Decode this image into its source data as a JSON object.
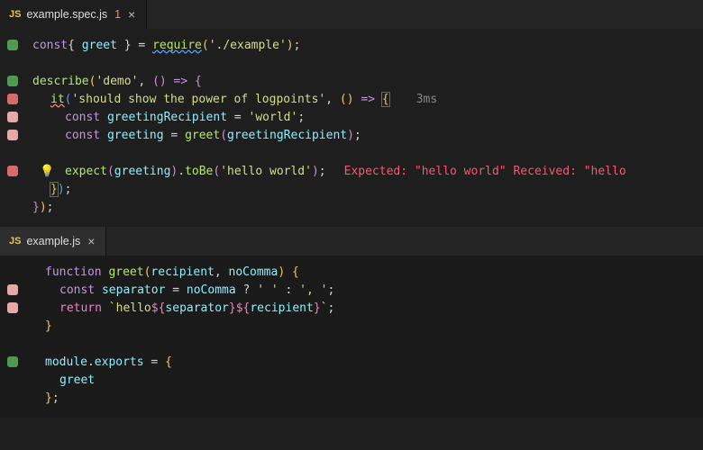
{
  "panes": [
    {
      "tab": {
        "filename": "example.spec.js",
        "error_count": "1",
        "close": "×"
      }
    },
    {
      "tab": {
        "filename": "example.js",
        "close": "×"
      }
    }
  ],
  "spec": {
    "l1": {
      "kw": "const",
      "brace_open": "{ ",
      "v": "greet",
      "brace_close": " }",
      "eq": " = ",
      "fn": "require",
      "po": "(",
      "str": "'./example'",
      "pc": ")",
      "semi": ";"
    },
    "l3": {
      "fn": "describe",
      "po": "(",
      "str": "'demo'",
      "comma": ", ",
      "pp": "(",
      "ppc": ")",
      "arrow": " => ",
      "cb": "{"
    },
    "l4": {
      "it": "it",
      "po": "(",
      "str": "'should show the power of logpoints'",
      "comma": ", ",
      "pp": "(",
      "ppc": ")",
      "arrow": " => ",
      "cb": "{",
      "annot": "3ms"
    },
    "l5": {
      "kw": "const",
      "sp": " ",
      "v": "greetingRecipient",
      "eq": " = ",
      "str": "'world'",
      "semi": ";"
    },
    "l6": {
      "kw": "const",
      "sp": " ",
      "v": "greeting",
      "eq": " = ",
      "fn": "greet",
      "po": "(",
      "arg": "greetingRecipient",
      "pc": ")",
      "semi": ";"
    },
    "l8": {
      "fn": "expect",
      "po": "(",
      "arg": "greeting",
      "pc": ")",
      "dot": ".",
      "fn2": "toBe",
      "po2": "(",
      "str": "'hello world'",
      "pc2": ")",
      "semi": ";",
      "err": "Expected: \"hello world\" Received: \"hello"
    },
    "l9": {
      "close": "});"
    },
    "l10": {
      "close": "});"
    }
  },
  "ex": {
    "l1": {
      "kw": "function",
      "sp": " ",
      "name": "greet",
      "po": "(",
      "p1": "recipient",
      "comma": ", ",
      "p2": "noComma",
      "pc": ")",
      "sp2": " ",
      "cb": "{"
    },
    "l2": {
      "kw": "const",
      "sp": " ",
      "v": "separator",
      "eq": " = ",
      "cond": "noComma",
      "q": " ? ",
      "s1": "' '",
      "col": " : ",
      "s2": "', '",
      "semi": ";"
    },
    "l3": {
      "kw": "return",
      "sp": " ",
      "t_open": "`hello",
      "i1_o": "${",
      "i1": "separator",
      "i1_c": "}",
      "i2_o": "${",
      "i2": "recipient",
      "i2_c": "}",
      "t_close": "`",
      "semi": ";"
    },
    "l4": {
      "close": "}"
    },
    "l6": {
      "obj": "module",
      "dot": ".",
      "prop": "exports",
      "eq": " = ",
      "cb": "{"
    },
    "l7": {
      "v": "greet"
    },
    "l8": {
      "close": "};"
    }
  }
}
